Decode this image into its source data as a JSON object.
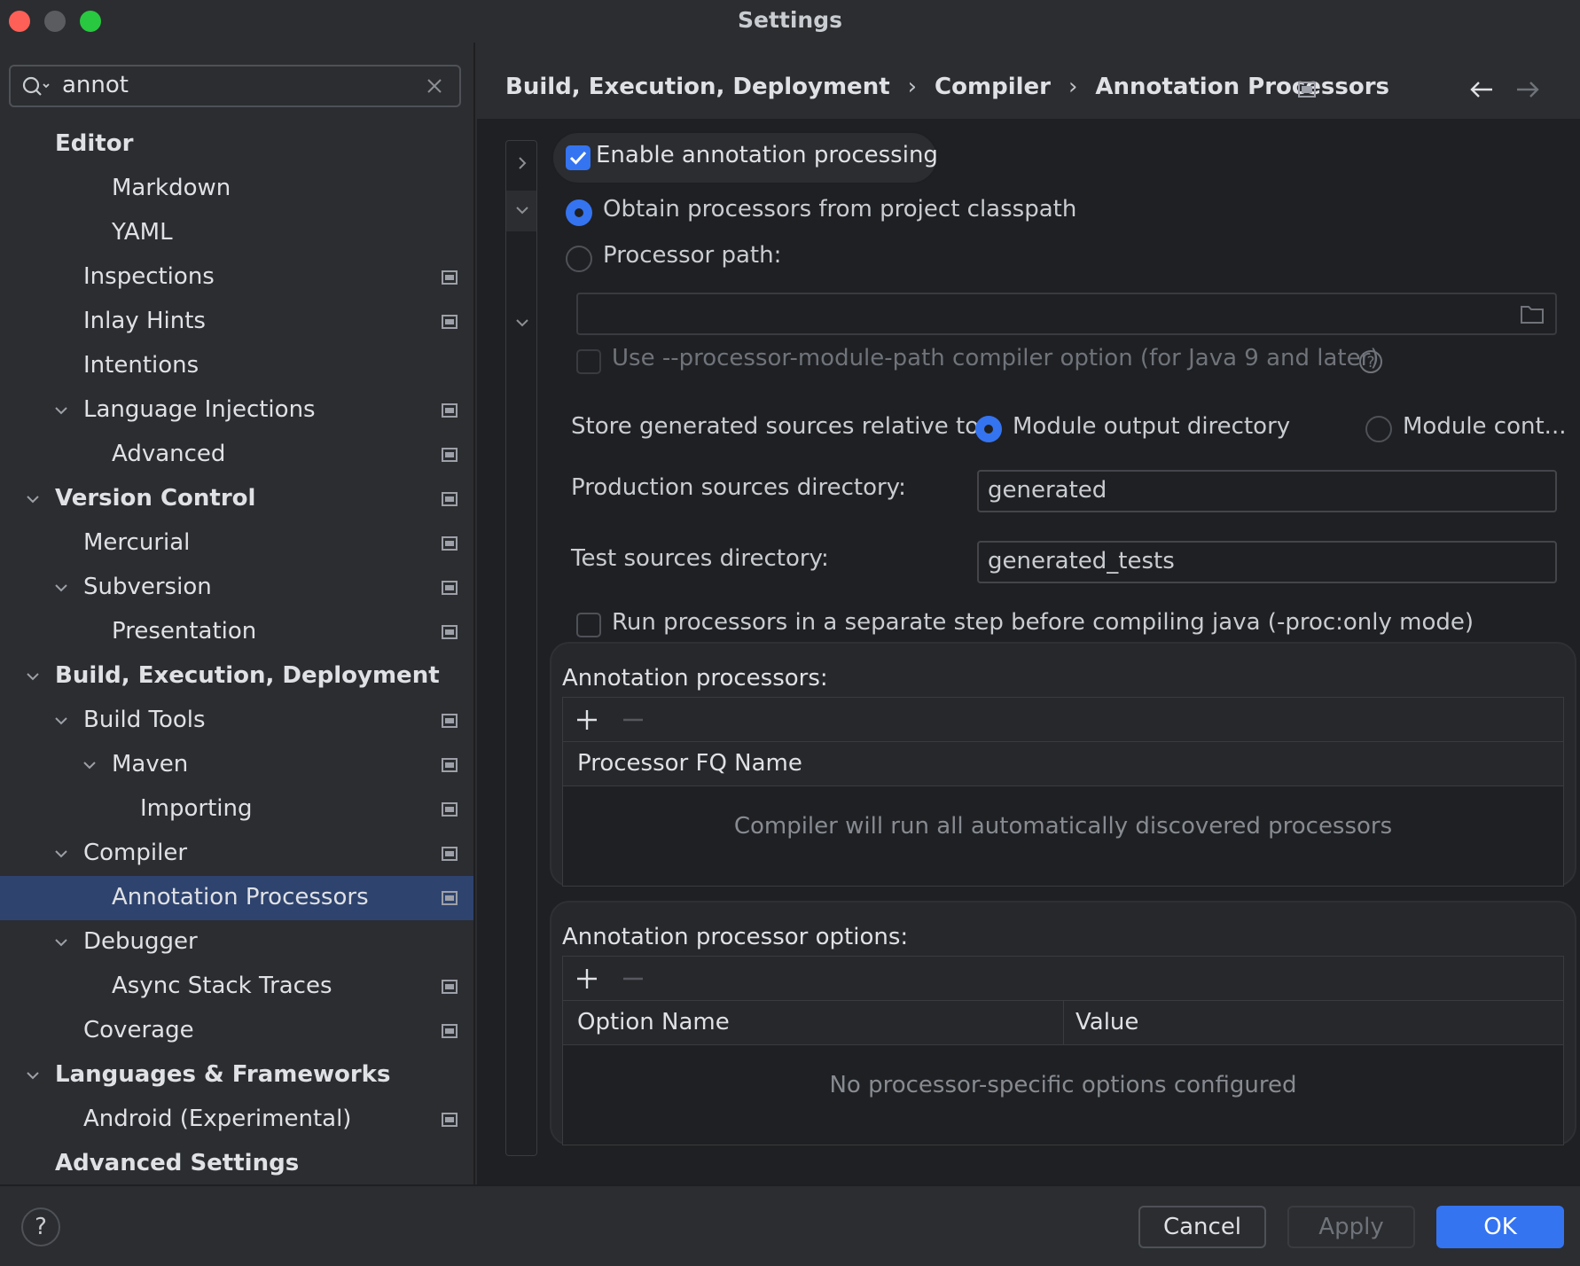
{
  "window": {
    "title": "Settings"
  },
  "search": {
    "query": "annot"
  },
  "tree": [
    {
      "label": "Editor",
      "bold": true,
      "indent": 0,
      "expanded": null,
      "pinned": false
    },
    {
      "label": "Markdown",
      "bold": false,
      "indent": 2,
      "expanded": null,
      "pinned": false
    },
    {
      "label": "YAML",
      "bold": false,
      "indent": 2,
      "expanded": null,
      "pinned": false
    },
    {
      "label": "Inspections",
      "bold": false,
      "indent": 1,
      "expanded": null,
      "pinned": true
    },
    {
      "label": "Inlay Hints",
      "bold": false,
      "indent": 1,
      "expanded": null,
      "pinned": true
    },
    {
      "label": "Intentions",
      "bold": false,
      "indent": 1,
      "expanded": null,
      "pinned": false
    },
    {
      "label": "Language Injections",
      "bold": false,
      "indent": 1,
      "expanded": true,
      "pinned": true
    },
    {
      "label": "Advanced",
      "bold": false,
      "indent": 2,
      "expanded": null,
      "pinned": true
    },
    {
      "label": "Version Control",
      "bold": true,
      "indent": 0,
      "expanded": true,
      "pinned": true
    },
    {
      "label": "Mercurial",
      "bold": false,
      "indent": 1,
      "expanded": null,
      "pinned": true
    },
    {
      "label": "Subversion",
      "bold": false,
      "indent": 1,
      "expanded": true,
      "pinned": true
    },
    {
      "label": "Presentation",
      "bold": false,
      "indent": 2,
      "expanded": null,
      "pinned": true
    },
    {
      "label": "Build, Execution, Deployment",
      "bold": true,
      "indent": 0,
      "expanded": true,
      "pinned": false
    },
    {
      "label": "Build Tools",
      "bold": false,
      "indent": 1,
      "expanded": true,
      "pinned": true
    },
    {
      "label": "Maven",
      "bold": false,
      "indent": 2,
      "expanded": true,
      "pinned": true
    },
    {
      "label": "Importing",
      "bold": false,
      "indent": 3,
      "expanded": null,
      "pinned": true
    },
    {
      "label": "Compiler",
      "bold": false,
      "indent": 1,
      "expanded": true,
      "pinned": true
    },
    {
      "label": "Annotation Processors",
      "bold": false,
      "indent": 2,
      "expanded": null,
      "pinned": true,
      "selected": true
    },
    {
      "label": "Debugger",
      "bold": false,
      "indent": 1,
      "expanded": true,
      "pinned": false
    },
    {
      "label": "Async Stack Traces",
      "bold": false,
      "indent": 2,
      "expanded": null,
      "pinned": true
    },
    {
      "label": "Coverage",
      "bold": false,
      "indent": 1,
      "expanded": null,
      "pinned": true
    },
    {
      "label": "Languages & Frameworks",
      "bold": true,
      "indent": 0,
      "expanded": true,
      "pinned": false
    },
    {
      "label": "Android (Experimental)",
      "bold": false,
      "indent": 1,
      "expanded": null,
      "pinned": true
    },
    {
      "label": "Advanced Settings",
      "bold": true,
      "indent": 0,
      "expanded": null,
      "pinned": false
    }
  ],
  "breadcrumb": {
    "items": [
      "Build, Execution, Deployment",
      "Compiler",
      "Annotation Processors"
    ],
    "separator": "›"
  },
  "form": {
    "enable_label": "Enable annotation processing",
    "enable_checked": true,
    "obtain_label": "Obtain processors from project classpath",
    "processor_path_label": "Processor path:",
    "processor_path_value": "",
    "module_path_label": "Use --processor-module-path compiler option (for Java 9 and later)",
    "store_label": "Store generated sources relative to:",
    "store_opt1": "Module output directory",
    "store_opt2": "Module cont...",
    "prod_label": "Production sources directory:",
    "prod_value": "generated",
    "test_label": "Test sources directory:",
    "test_value": "generated_tests",
    "run_separate_label": "Run processors in a separate step before compiling java (-proc:only mode)"
  },
  "processors_panel": {
    "title": "Annotation processors:",
    "column": "Processor FQ Name",
    "empty": "Compiler will run all automatically discovered processors"
  },
  "options_panel": {
    "title": "Annotation processor options:",
    "col_name": "Option Name",
    "col_value": "Value",
    "empty": "No processor-specific options configured"
  },
  "footer": {
    "help": "?",
    "cancel": "Cancel",
    "apply": "Apply",
    "ok": "OK"
  },
  "colors": {
    "accent": "#3574f0",
    "selection": "#2e436e",
    "background": "#2b2d30",
    "content_bg": "#1f2023"
  }
}
